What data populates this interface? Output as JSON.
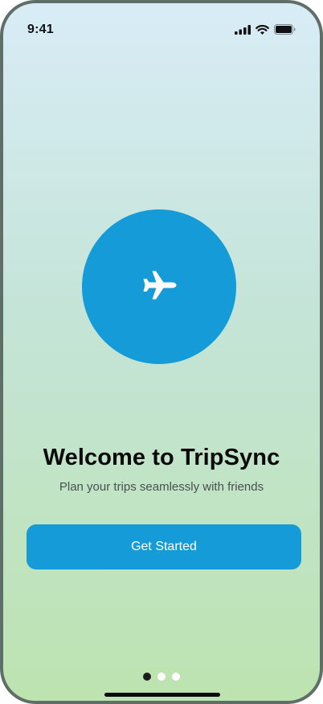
{
  "status_bar": {
    "time": "9:41",
    "icons": [
      "cellular-signal-icon",
      "wifi-icon",
      "battery-icon"
    ]
  },
  "hero": {
    "icon": "airplane-icon",
    "circle_color": "#159bd8"
  },
  "onboarding": {
    "title": "Welcome to TripSync",
    "subtitle": "Plan your trips seamlessly with friends",
    "cta_label": "Get Started"
  },
  "pagination": {
    "current_page": 1,
    "total_pages": 3
  },
  "colors": {
    "accent": "#159bd8",
    "background_top": "#d8ecf6",
    "background_bottom": "#bde3b0",
    "title": "#0a0a0a",
    "subtitle": "#4a4f52"
  }
}
